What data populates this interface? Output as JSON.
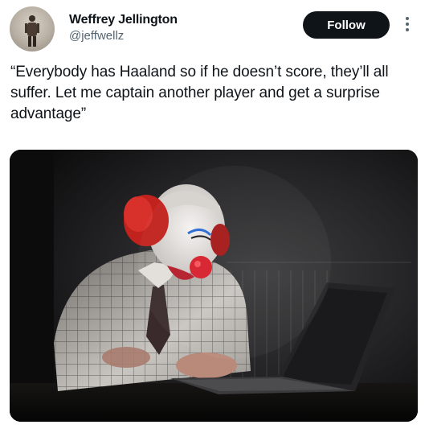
{
  "author": {
    "name": "Weffrey Jellington",
    "handle": "@jeffwellz",
    "avatar_alt": "profile photo"
  },
  "actions": {
    "follow_label": "Follow",
    "more_icon": "more-options-icon"
  },
  "tweet": {
    "text": "“Everybody has Haaland so if he doesn’t score, they’ll all suffer. Let me captain another player and get a surprise advantage”"
  },
  "media": {
    "description": "photo"
  }
}
